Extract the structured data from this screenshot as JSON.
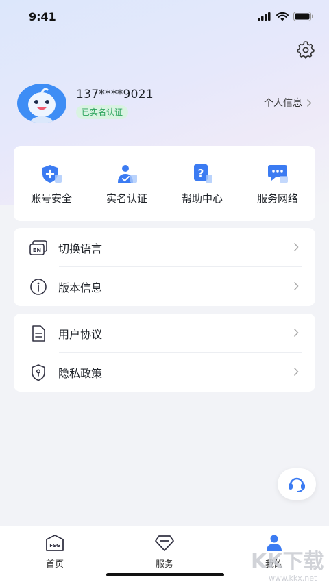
{
  "status_bar": {
    "time": "9:41"
  },
  "profile": {
    "phone": "137****9021",
    "verified_badge": "已实名认证",
    "personal_info_label": "个人信息"
  },
  "quick_actions": [
    {
      "label": "账号安全",
      "icon": "shield-plus-icon"
    },
    {
      "label": "实名认证",
      "icon": "person-check-icon"
    },
    {
      "label": "帮助中心",
      "icon": "help-question-icon"
    },
    {
      "label": "服务网络",
      "icon": "chat-dots-icon"
    }
  ],
  "menu_group_1": [
    {
      "label": "切换语言",
      "icon": "language-en-icon"
    },
    {
      "label": "版本信息",
      "icon": "info-circle-icon"
    }
  ],
  "menu_group_2": [
    {
      "label": "用户协议",
      "icon": "document-icon"
    },
    {
      "label": "隐私政策",
      "icon": "shield-lock-icon"
    }
  ],
  "tabbar": [
    {
      "label": "首页",
      "icon": "fsg-home-icon"
    },
    {
      "label": "服务",
      "icon": "diamond-icon"
    },
    {
      "label": "我的",
      "icon": "user-icon",
      "active": true
    }
  ],
  "watermark": {
    "text": "KK下载",
    "url_text": "www.kkx.net"
  },
  "colors": {
    "accent": "#3b7bf2",
    "verified_text": "#29a35a",
    "verified_bg": "#d9f3e2"
  }
}
